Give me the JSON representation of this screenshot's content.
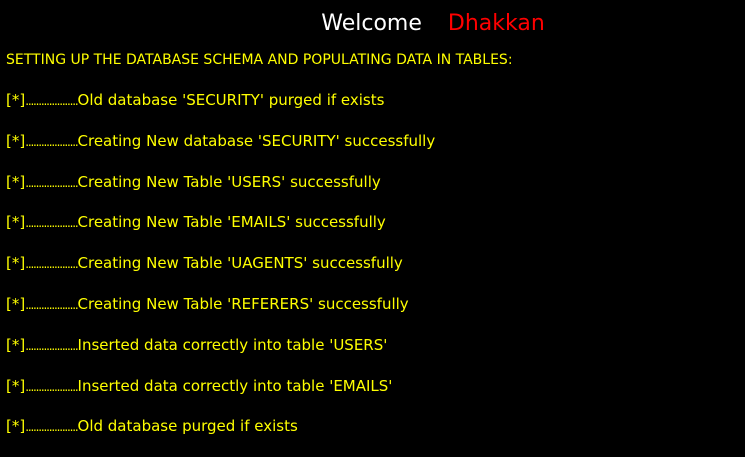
{
  "header": {
    "welcome_label": "Welcome",
    "username": "Dhakkan"
  },
  "heading": "SETTING UP THE DATABASE SCHEMA AND POPULATING DATA IN TABLES:",
  "log_marker": "[*]",
  "log_dots": "....................",
  "log_lines": [
    "Old database 'SECURITY' purged if exists",
    "Creating New database 'SECURITY' successfully",
    "Creating New Table 'USERS' successfully",
    "Creating New Table 'EMAILS' successfully",
    "Creating New Table 'UAGENTS' successfully",
    "Creating New Table 'REFERERS' successfully",
    "Inserted data correctly into table 'USERS'",
    "Inserted data correctly into table 'EMAILS'",
    "Old database purged if exists"
  ],
  "colors": {
    "background": "#000000",
    "log_text": "#ffff00",
    "welcome_text": "#ffffff",
    "username_text": "#ff0000"
  }
}
